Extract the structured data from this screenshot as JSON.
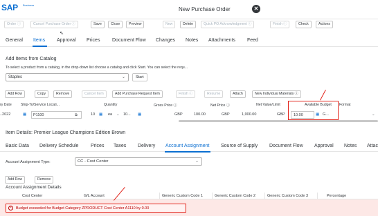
{
  "app": {
    "logo": "SAP",
    "logo_sub": "Business",
    "title": "New Purchase Order"
  },
  "toolbar": {
    "buttons": [
      {
        "label": "Order ⓘ",
        "enabled": false
      },
      {
        "label": "Cancel Purchase Order ⓘ",
        "enabled": false
      },
      {
        "label": "Save",
        "enabled": true
      },
      {
        "label": "Close",
        "enabled": true
      },
      {
        "label": "Preview",
        "enabled": true
      },
      {
        "label": "New",
        "enabled": false
      },
      {
        "label": "Delete",
        "enabled": true
      },
      {
        "label": "Quick PO Acknowledgment ⓘ",
        "enabled": false
      },
      {
        "label": "Finish ⓘ",
        "enabled": false
      },
      {
        "label": "Check",
        "enabled": true
      },
      {
        "label": "Actions",
        "enabled": true
      }
    ]
  },
  "tabs": [
    "General",
    "Items",
    "Approval",
    "Prices",
    "Document Flow",
    "Changes",
    "Notes",
    "Attachments",
    "Feed"
  ],
  "active_tab": "Items",
  "catalog": {
    "title": "Add Items from Catalog",
    "hint": "To select a product from a catalog, in the drop-down list choose a catalog and click Start. You can select the requ...",
    "selected": "Staples",
    "start_label": "Start"
  },
  "items_toolbar": {
    "buttons": [
      {
        "label": "Add Row",
        "enabled": true
      },
      {
        "label": "Copy",
        "enabled": true
      },
      {
        "label": "Remove",
        "enabled": true
      },
      {
        "label": "Cancel Item",
        "enabled": false
      },
      {
        "label": "Add Purchase Request Item",
        "enabled": true
      },
      {
        "label": "Finish ⓘ",
        "enabled": false
      },
      {
        "label": "Resume",
        "enabled": false
      },
      {
        "label": "Attach",
        "enabled": true
      },
      {
        "label": "New Individual Materials ⓘ",
        "enabled": true
      }
    ]
  },
  "items_grid": {
    "headers": {
      "delivery_date": "ry Date",
      "ship_to": "Ship-To/Service Locati...",
      "quantity": "Quantity",
      "gross_price": "Gross Price ⓘ",
      "net_price": "Net Price ⓘ",
      "net_value": "Net Value/Limit",
      "available_budget": "Available Budget",
      "format": "Format"
    },
    "row": {
      "delivery_date": "..2022",
      "ship_to": "P1100",
      "quantity": "10",
      "unit": "ea",
      "qty2": "10...",
      "currency1": "GBP",
      "gross_price": "100.00",
      "currency2": "GBP",
      "net_price": "1,000.00",
      "currency3": "GBP",
      "available_budget": "10.00",
      "format": "G..."
    }
  },
  "item_details": {
    "title": "Item Details: Premier League Champions Edition Brown",
    "tabs": [
      "Basic Data",
      "Delivery Schedule",
      "Prices",
      "Taxes",
      "Delivery",
      "Account Assignment",
      "Source of Supply",
      "Document Flow",
      "Approval",
      "Notes",
      "Attac"
    ],
    "active_tab": "Account Assignment",
    "aa_type_label": "Account Assignment Type:",
    "aa_type_value": "CC - Cost Center",
    "add_row": "Add Row",
    "remove": "Remove",
    "details_title": "Account Assignment Details",
    "columns": [
      "Cost Center",
      "G/L Account",
      "Generic Custom Code 1",
      "Generic Custom Code 2",
      "Generic Custom Code 3",
      "Percentage"
    ]
  },
  "error": {
    "text": "Budget exceeded for Budget Category ZPRODUCT Cost Center A1110 by 0.00"
  },
  "colors": {
    "accent": "#0a6ed1",
    "error": "#bb0000",
    "annotation": "#e2231a"
  }
}
